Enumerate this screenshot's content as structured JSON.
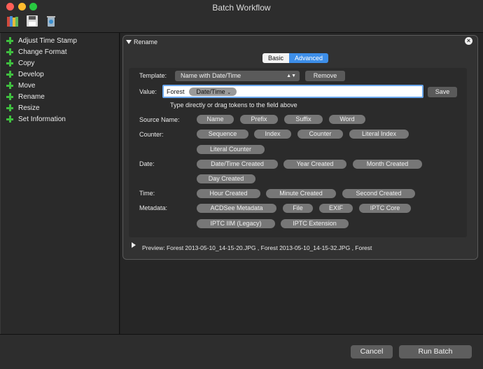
{
  "window": {
    "title": "Batch Workflow"
  },
  "toolbar": {
    "icons": [
      "books-icon",
      "save-icon",
      "trash-icon"
    ]
  },
  "sidebar": {
    "items": [
      {
        "label": "Adjust Time Stamp"
      },
      {
        "label": "Change Format"
      },
      {
        "label": "Copy"
      },
      {
        "label": "Develop"
      },
      {
        "label": "Move"
      },
      {
        "label": "Rename"
      },
      {
        "label": "Resize"
      },
      {
        "label": "Set Information"
      }
    ]
  },
  "panel": {
    "title": "Rename",
    "modes": {
      "basic": "Basic",
      "advanced": "Advanced",
      "selected": "Advanced"
    },
    "template_label": "Template:",
    "template_value": "Name with Date/Time",
    "remove_label": "Remove",
    "value_label": "Value:",
    "value_text": "Forest",
    "value_token": "Date/Time",
    "save_label": "Save",
    "hint": "Type directly or drag tokens to the field above",
    "groups": {
      "source": {
        "label": "Source Name:",
        "tokens": [
          "Name",
          "Prefix",
          "Suffix",
          "Word"
        ]
      },
      "counter": {
        "label": "Counter:",
        "tokens": [
          "Sequence",
          "Index",
          "Counter",
          "Literal Index",
          "Literal Counter"
        ]
      },
      "date": {
        "label": "Date:",
        "tokens": [
          "Date/Time Created",
          "Year Created",
          "Month Created",
          "Day Created"
        ]
      },
      "time": {
        "label": "Time:",
        "tokens": [
          "Hour Created",
          "Minute Created",
          "Second Created"
        ]
      },
      "metadata": {
        "label": "Metadata:",
        "tokens": [
          "ACDSee Metadata",
          "File",
          "EXIF",
          "IPTC Core",
          "IPTC IIM (Legacy)",
          "IPTC Extension"
        ]
      }
    },
    "preview_label": "Preview:",
    "preview_text": "Forest 2013-05-10_14-15-20.JPG , Forest 2013-05-10_14-15-32.JPG , Forest"
  },
  "footer": {
    "cancel_label": "Cancel",
    "run_label": "Run Batch"
  },
  "colors": {
    "accent": "#3d8ee8",
    "add": "#3fbf3f"
  }
}
